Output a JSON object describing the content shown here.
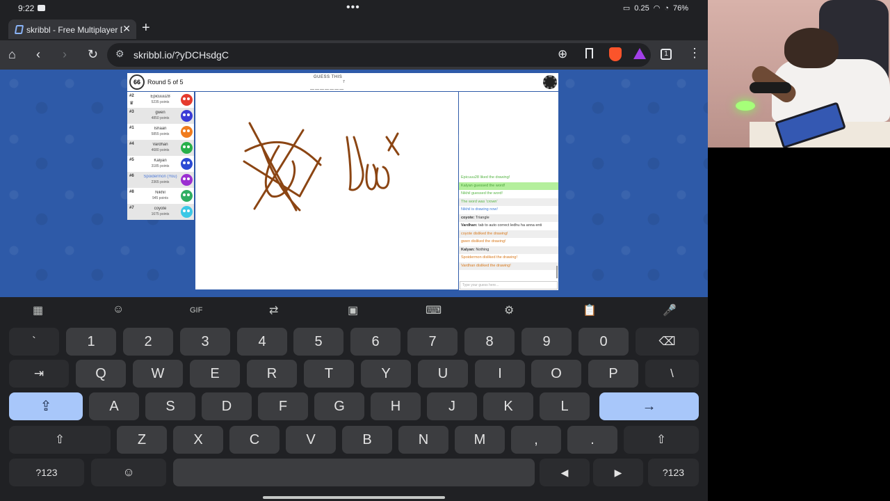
{
  "status_bar": {
    "time": "9:22",
    "dots": "•••",
    "net_speed": "0.25",
    "battery": "76%"
  },
  "tab": {
    "title": "skribbl - Free Multiplayer Dra",
    "close": "✕",
    "new_tab": "+"
  },
  "toolbar": {
    "url": "skribbl.io/?yDCHsdgC",
    "tab_count": "1"
  },
  "game": {
    "timer": "66",
    "round_text": "Round 5 of 5",
    "guess_label": "GUESS THIS",
    "word_hint": "_______",
    "word_length": "7",
    "players": [
      {
        "rank": "#2",
        "name": "Epicuuu28",
        "points": "5235 points",
        "color": "#e53b2e",
        "you": false
      },
      {
        "rank": "#3",
        "name": "gwen",
        "points": "4850 points",
        "color": "#3b3bd6",
        "you": false
      },
      {
        "rank": "#1",
        "name": "Ishaan",
        "points": "5855 points",
        "color": "#f07c1e",
        "you": false
      },
      {
        "rank": "#4",
        "name": "Vardhan",
        "points": "4680 points",
        "color": "#27b04a",
        "you": false
      },
      {
        "rank": "#5",
        "name": "Kalyan",
        "points": "3185 points",
        "color": "#2c4bd4",
        "you": false
      },
      {
        "rank": "#6",
        "name": "Spoidermon (You)",
        "points": "2365 points",
        "color": "#9b2fd1",
        "you": true
      },
      {
        "rank": "#8",
        "name": "Nikhil",
        "points": "945 points",
        "color": "#2fae63",
        "you": false
      },
      {
        "rank": "#7",
        "name": "coyote",
        "points": "1675 points",
        "color": "#3bc8e6",
        "you": false
      }
    ],
    "chat": [
      {
        "who": "",
        "text": "Epicuuu28 liked the drawing!",
        "style": "green"
      },
      {
        "who": "",
        "text": "Kalyan guessed the word!",
        "style": "guessed"
      },
      {
        "who": "",
        "text": "Nikhil guessed the word!",
        "style": "green"
      },
      {
        "who": "",
        "text": "The word was 'crown'",
        "style": "green"
      },
      {
        "who": "",
        "text": "Nikhil is drawing now!",
        "style": "blue"
      },
      {
        "who": "coyote:",
        "text": " Triangle",
        "style": ""
      },
      {
        "who": "Vardhan:",
        "text": " tab to auto correct ledhu ha anna enti",
        "style": ""
      },
      {
        "who": "",
        "text": "coyote disliked the drawing!",
        "style": "orange"
      },
      {
        "who": "",
        "text": "gwen disliked the drawing!",
        "style": "orange"
      },
      {
        "who": "Kalyan:",
        "text": " Nothing",
        "style": ""
      },
      {
        "who": "",
        "text": "Spoidermon disliked the drawing!",
        "style": "orange"
      },
      {
        "who": "",
        "text": "Vardhan disliked the drawing!",
        "style": "orange"
      }
    ],
    "chat_placeholder": "Type your guess here..."
  },
  "keyboard": {
    "gif": "GIF",
    "row1": [
      "`",
      "1",
      "2",
      "3",
      "4",
      "5",
      "6",
      "7",
      "8",
      "9",
      "0",
      "⌫"
    ],
    "row2": [
      "⇥",
      "Q",
      "W",
      "E",
      "R",
      "T",
      "Y",
      "U",
      "I",
      "O",
      "P",
      "\\"
    ],
    "row3": [
      "⇪",
      "A",
      "S",
      "D",
      "F",
      "G",
      "H",
      "J",
      "K",
      "L",
      "→"
    ],
    "row4": [
      "⇧",
      "Z",
      "X",
      "C",
      "V",
      "B",
      "N",
      "M",
      ",",
      ".",
      "⇧"
    ],
    "row5": [
      "?123",
      "☺",
      "",
      "◀",
      "▶",
      "?123"
    ]
  },
  "colors": {
    "brush": "#8b4513",
    "background": "#2e5aa8"
  }
}
